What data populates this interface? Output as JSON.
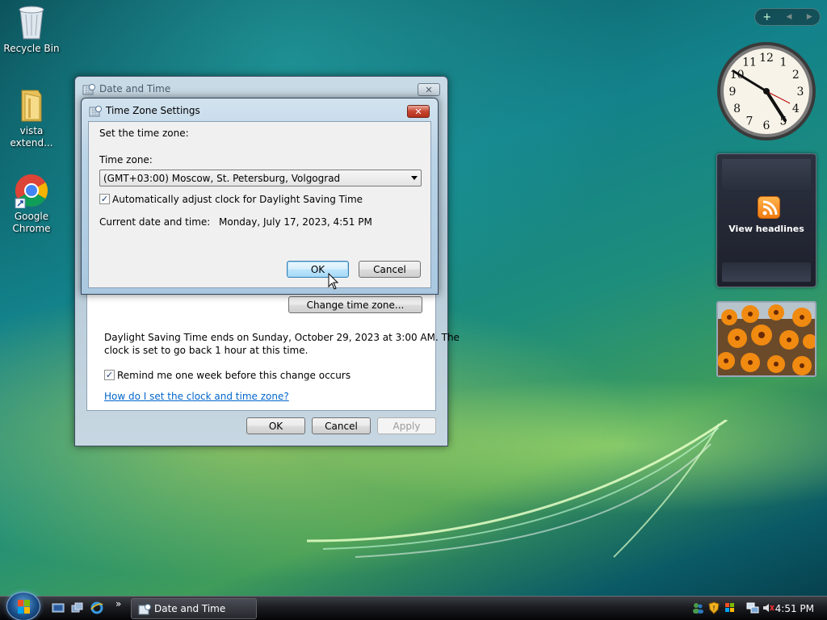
{
  "desktop": {
    "icons": [
      {
        "label": "Recycle Bin"
      },
      {
        "label": "vista extend..."
      },
      {
        "label": "Google Chrome"
      }
    ]
  },
  "gadgets": {
    "sidebar_controls": [
      "+",
      "◀",
      "▶"
    ],
    "clock": {
      "numerals": [
        "12",
        "1",
        "2",
        "3",
        "4",
        "5",
        "6",
        "7",
        "8",
        "9",
        "10",
        "11"
      ],
      "time": "4:51"
    },
    "news": {
      "label": "View headlines",
      "icon": "rss-icon"
    },
    "slideshow": {
      "icon": "flowers-photo"
    }
  },
  "date_time_window": {
    "title": "Date and Time",
    "change_tz_button": "Change time zone...",
    "dst_info": [
      "Daylight Saving Time ends on Sunday, October 29, 2023 at 3:00 AM. The",
      "clock is set to go back 1 hour at this time."
    ],
    "remind_label": "Remind me one week before this change occurs",
    "remind_checked": true,
    "help_link": "How do I set the clock and time zone?",
    "ok": "OK",
    "cancel": "Cancel",
    "apply": "Apply"
  },
  "tz_dialog": {
    "title": "Time Zone Settings",
    "heading": "Set the time zone:",
    "tz_label": "Time zone:",
    "tz_value": "(GMT+03:00) Moscow, St. Petersburg, Volgograd",
    "auto_dst_label": "Automatically adjust clock for Daylight Saving Time",
    "auto_dst_checked": true,
    "current_label": "Current date and time:",
    "current_value": "Monday, July 17, 2023, 4:51 PM",
    "ok": "OK",
    "cancel": "Cancel"
  },
  "taskbar": {
    "task_label": "Date and Time",
    "overflow": "»",
    "clock": "4:51 PM"
  },
  "colors": {
    "accent": "#3c7fb1",
    "link": "#0066cc"
  }
}
